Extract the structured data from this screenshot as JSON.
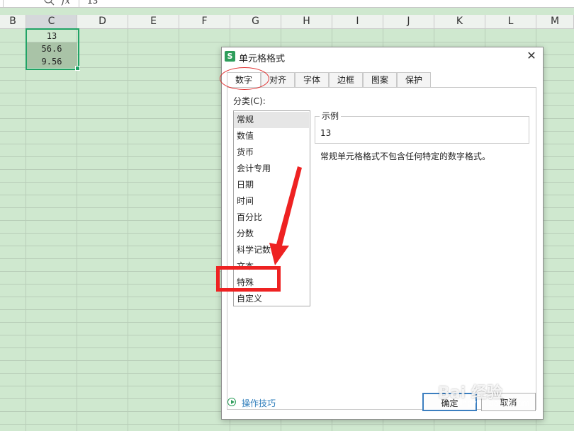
{
  "formula_bar": {
    "value": "13",
    "fx_label": "fx"
  },
  "columns": [
    "B",
    "C",
    "D",
    "E",
    "F",
    "G",
    "H",
    "I",
    "J",
    "K",
    "L",
    "M"
  ],
  "selected_column": "C",
  "cells": [
    {
      "col": "C",
      "value": "13"
    },
    {
      "col": "C",
      "value": "56.6"
    },
    {
      "col": "C",
      "value": "9.56"
    }
  ],
  "dialog": {
    "title": "单元格格式",
    "app_icon_letter": "S",
    "tabs": [
      {
        "label": "数字",
        "active": true
      },
      {
        "label": "对齐"
      },
      {
        "label": "字体"
      },
      {
        "label": "边框"
      },
      {
        "label": "图案"
      },
      {
        "label": "保护"
      }
    ],
    "category_label": "分类(C):",
    "categories": [
      "常规",
      "数值",
      "货币",
      "会计专用",
      "日期",
      "时间",
      "百分比",
      "分数",
      "科学记数",
      "文本",
      "特殊",
      "自定义"
    ],
    "selected_category": "常规",
    "sample_legend": "示例",
    "sample_value": "13",
    "description": "常规单元格格式不包含任何特定的数字格式。",
    "tips_link": "操作技巧",
    "ok_label": "确定",
    "cancel_label": "取消"
  },
  "watermark": {
    "text": "Bai 经验",
    "sub": "jingyan.baidu.com"
  },
  "colors": {
    "sheet_bg": "#cfe8cf",
    "selection": "#21a366",
    "annotation": "#ee2222",
    "link": "#2e7dbb"
  }
}
